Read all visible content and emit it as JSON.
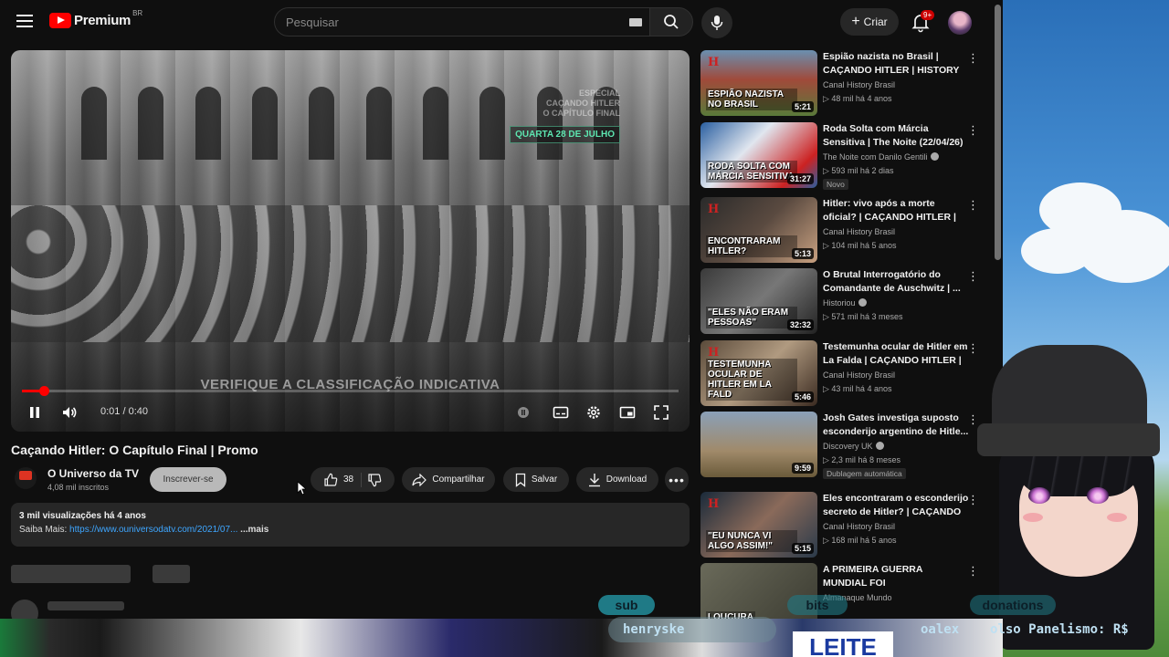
{
  "header": {
    "logo_text": "Premium",
    "logo_region": "BR",
    "search_placeholder": "Pesquisar",
    "create_label": "Criar",
    "notifications_badge": "9+"
  },
  "player": {
    "overlay_lines": [
      "ESPECIAL",
      "CAÇANDO HITLER",
      "O CAPÍTULO FINAL"
    ],
    "overlay_date": "QUARTA 28 DE JULHO",
    "rating_notice": "VERIFIQUE A CLASSIFICAÇÃO INDICATIVA",
    "time": "0:01 / 0:40",
    "progress": 0.034
  },
  "video": {
    "title": "Caçando Hitler: O Capítulo Final | Promo",
    "channel_name": "O Universo da TV",
    "channel_subs": "4,08 mil inscritos",
    "subscribe_label": "Inscrever-se",
    "likes": "38",
    "share_label": "Compartilhar",
    "save_label": "Salvar",
    "download_label": "Download",
    "description_meta": "3 mil visualizações  há 4 anos",
    "description_prefix": "Saiba Mais: ",
    "description_link": "https://www.ouniversodatv.com/2021/07...",
    "description_more": "...mais"
  },
  "recommendations": [
    {
      "title": "Espião nazista no Brasil | CAÇANDO HITLER | HISTORY",
      "channel": "Canal History Brasil",
      "meta": "48 mil  há 4 anos",
      "duration": "5:21",
      "thumb_caption": "ESPIÃO NAZISTA NO BRASIL",
      "verified": false,
      "badge": ""
    },
    {
      "title": "Roda Solta com Márcia Sensitiva | The Noite (22/04/26)",
      "channel": "The Noite com Danilo Gentili",
      "meta": "593 mil  há 2 dias",
      "duration": "31:27",
      "thumb_caption": "RODA SOLTA COM MÁRCIA SENSITIVA",
      "verified": true,
      "badge": "Novo"
    },
    {
      "title": "Hitler: vivo após a morte oficial? | CAÇANDO HITLER | HISTORY",
      "channel": "Canal History Brasil",
      "meta": "104 mil  há 5 anos",
      "duration": "5:13",
      "thumb_caption": "ENCONTRARAM HITLER?",
      "verified": false,
      "badge": ""
    },
    {
      "title": "O Brutal Interrogatório do Comandante de Auschwitz | ...",
      "channel": "Historiou",
      "meta": "571 mil  há 3 meses",
      "duration": "32:32",
      "thumb_caption": "\"ELES NÃO ERAM PESSOAS\"",
      "verified": true,
      "badge": ""
    },
    {
      "title": "Testemunha ocular de Hitler em La Falda | CAÇANDO HITLER | ...",
      "channel": "Canal History Brasil",
      "meta": "43 mil  há 4 anos",
      "duration": "5:46",
      "thumb_caption": "TESTEMUNHA OCULAR DE HITLER EM LA FALD",
      "verified": false,
      "badge": ""
    },
    {
      "title": "Josh Gates investiga suposto esconderijo argentino de Hitle...",
      "channel": "Discovery UK",
      "meta": "2,3 mil  há 8 meses",
      "duration": "9:59",
      "thumb_caption": "",
      "verified": true,
      "badge": "Dublagem automática"
    },
    {
      "title": "Eles encontraram o esconderijo secreto de Hitler? | CAÇANDO ...",
      "channel": "Canal History Brasil",
      "meta": "168 mil  há 5 anos",
      "duration": "5:15",
      "thumb_caption": "\"EU NUNCA VI ALGO ASSIM!\"",
      "verified": false,
      "badge": ""
    },
    {
      "title": "A PRIMEIRA GUERRA MUNDIAL FOI PERTURBADORA",
      "channel": "Almanaque Mundo",
      "meta": "",
      "duration": "",
      "thumb_caption": "LOUCURA",
      "verified": false,
      "badge": ""
    }
  ],
  "overlay": {
    "sub_label": "sub",
    "bits_label": "bits",
    "donations_label": "donations",
    "ticker_name": "henryske",
    "ticker_right": "oalex",
    "ticker_far_right": "olso Panelismo: R$",
    "leite_text": "LEITE"
  },
  "colors": {
    "background": "#0f0f0f",
    "accent": "#ff0000",
    "link": "#3ea6ff",
    "promo_green": "#5de6b0"
  }
}
